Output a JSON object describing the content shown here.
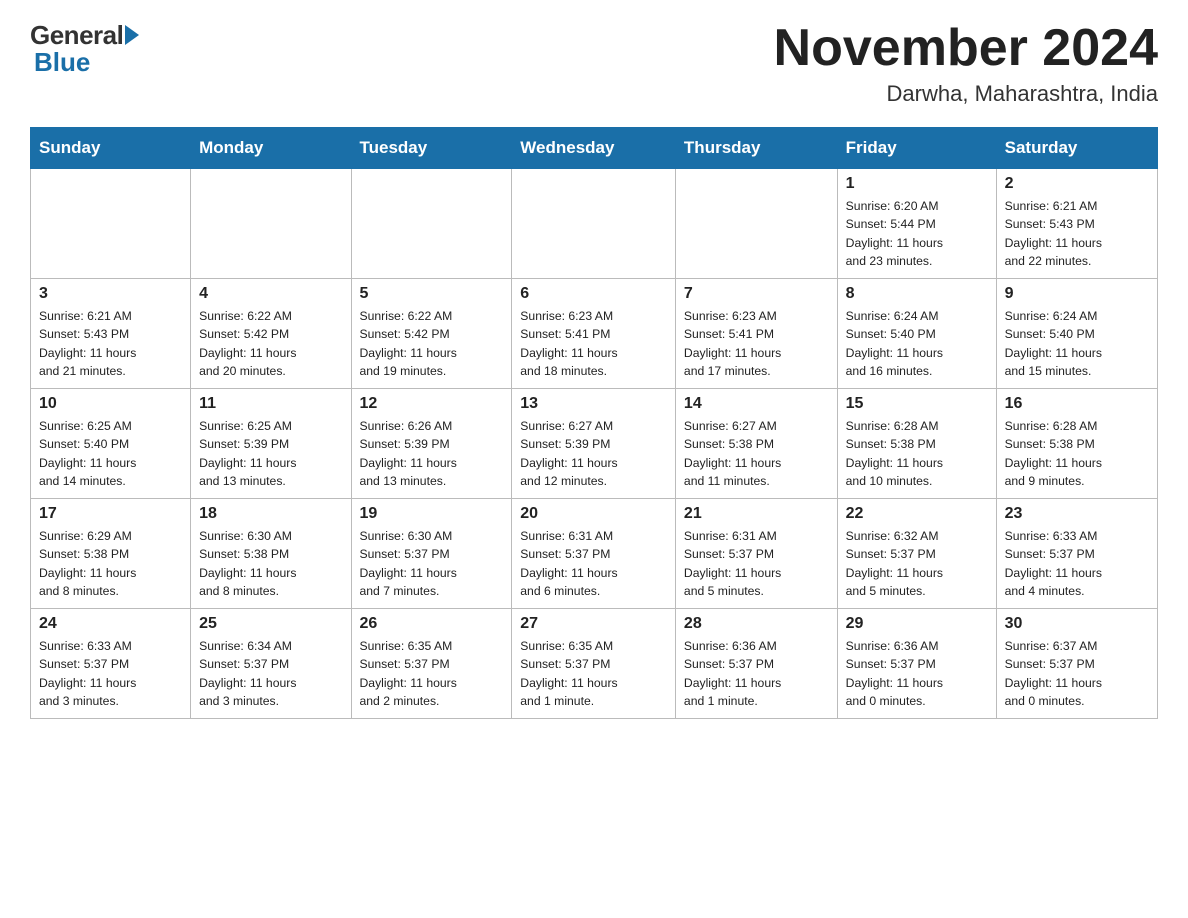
{
  "header": {
    "logo": {
      "general": "General",
      "blue": "Blue"
    },
    "title": "November 2024",
    "location": "Darwha, Maharashtra, India"
  },
  "days_of_week": [
    "Sunday",
    "Monday",
    "Tuesday",
    "Wednesday",
    "Thursday",
    "Friday",
    "Saturday"
  ],
  "weeks": [
    [
      {
        "day": "",
        "info": ""
      },
      {
        "day": "",
        "info": ""
      },
      {
        "day": "",
        "info": ""
      },
      {
        "day": "",
        "info": ""
      },
      {
        "day": "",
        "info": ""
      },
      {
        "day": "1",
        "info": "Sunrise: 6:20 AM\nSunset: 5:44 PM\nDaylight: 11 hours\nand 23 minutes."
      },
      {
        "day": "2",
        "info": "Sunrise: 6:21 AM\nSunset: 5:43 PM\nDaylight: 11 hours\nand 22 minutes."
      }
    ],
    [
      {
        "day": "3",
        "info": "Sunrise: 6:21 AM\nSunset: 5:43 PM\nDaylight: 11 hours\nand 21 minutes."
      },
      {
        "day": "4",
        "info": "Sunrise: 6:22 AM\nSunset: 5:42 PM\nDaylight: 11 hours\nand 20 minutes."
      },
      {
        "day": "5",
        "info": "Sunrise: 6:22 AM\nSunset: 5:42 PM\nDaylight: 11 hours\nand 19 minutes."
      },
      {
        "day": "6",
        "info": "Sunrise: 6:23 AM\nSunset: 5:41 PM\nDaylight: 11 hours\nand 18 minutes."
      },
      {
        "day": "7",
        "info": "Sunrise: 6:23 AM\nSunset: 5:41 PM\nDaylight: 11 hours\nand 17 minutes."
      },
      {
        "day": "8",
        "info": "Sunrise: 6:24 AM\nSunset: 5:40 PM\nDaylight: 11 hours\nand 16 minutes."
      },
      {
        "day": "9",
        "info": "Sunrise: 6:24 AM\nSunset: 5:40 PM\nDaylight: 11 hours\nand 15 minutes."
      }
    ],
    [
      {
        "day": "10",
        "info": "Sunrise: 6:25 AM\nSunset: 5:40 PM\nDaylight: 11 hours\nand 14 minutes."
      },
      {
        "day": "11",
        "info": "Sunrise: 6:25 AM\nSunset: 5:39 PM\nDaylight: 11 hours\nand 13 minutes."
      },
      {
        "day": "12",
        "info": "Sunrise: 6:26 AM\nSunset: 5:39 PM\nDaylight: 11 hours\nand 13 minutes."
      },
      {
        "day": "13",
        "info": "Sunrise: 6:27 AM\nSunset: 5:39 PM\nDaylight: 11 hours\nand 12 minutes."
      },
      {
        "day": "14",
        "info": "Sunrise: 6:27 AM\nSunset: 5:38 PM\nDaylight: 11 hours\nand 11 minutes."
      },
      {
        "day": "15",
        "info": "Sunrise: 6:28 AM\nSunset: 5:38 PM\nDaylight: 11 hours\nand 10 minutes."
      },
      {
        "day": "16",
        "info": "Sunrise: 6:28 AM\nSunset: 5:38 PM\nDaylight: 11 hours\nand 9 minutes."
      }
    ],
    [
      {
        "day": "17",
        "info": "Sunrise: 6:29 AM\nSunset: 5:38 PM\nDaylight: 11 hours\nand 8 minutes."
      },
      {
        "day": "18",
        "info": "Sunrise: 6:30 AM\nSunset: 5:38 PM\nDaylight: 11 hours\nand 8 minutes."
      },
      {
        "day": "19",
        "info": "Sunrise: 6:30 AM\nSunset: 5:37 PM\nDaylight: 11 hours\nand 7 minutes."
      },
      {
        "day": "20",
        "info": "Sunrise: 6:31 AM\nSunset: 5:37 PM\nDaylight: 11 hours\nand 6 minutes."
      },
      {
        "day": "21",
        "info": "Sunrise: 6:31 AM\nSunset: 5:37 PM\nDaylight: 11 hours\nand 5 minutes."
      },
      {
        "day": "22",
        "info": "Sunrise: 6:32 AM\nSunset: 5:37 PM\nDaylight: 11 hours\nand 5 minutes."
      },
      {
        "day": "23",
        "info": "Sunrise: 6:33 AM\nSunset: 5:37 PM\nDaylight: 11 hours\nand 4 minutes."
      }
    ],
    [
      {
        "day": "24",
        "info": "Sunrise: 6:33 AM\nSunset: 5:37 PM\nDaylight: 11 hours\nand 3 minutes."
      },
      {
        "day": "25",
        "info": "Sunrise: 6:34 AM\nSunset: 5:37 PM\nDaylight: 11 hours\nand 3 minutes."
      },
      {
        "day": "26",
        "info": "Sunrise: 6:35 AM\nSunset: 5:37 PM\nDaylight: 11 hours\nand 2 minutes."
      },
      {
        "day": "27",
        "info": "Sunrise: 6:35 AM\nSunset: 5:37 PM\nDaylight: 11 hours\nand 1 minute."
      },
      {
        "day": "28",
        "info": "Sunrise: 6:36 AM\nSunset: 5:37 PM\nDaylight: 11 hours\nand 1 minute."
      },
      {
        "day": "29",
        "info": "Sunrise: 6:36 AM\nSunset: 5:37 PM\nDaylight: 11 hours\nand 0 minutes."
      },
      {
        "day": "30",
        "info": "Sunrise: 6:37 AM\nSunset: 5:37 PM\nDaylight: 11 hours\nand 0 minutes."
      }
    ]
  ]
}
